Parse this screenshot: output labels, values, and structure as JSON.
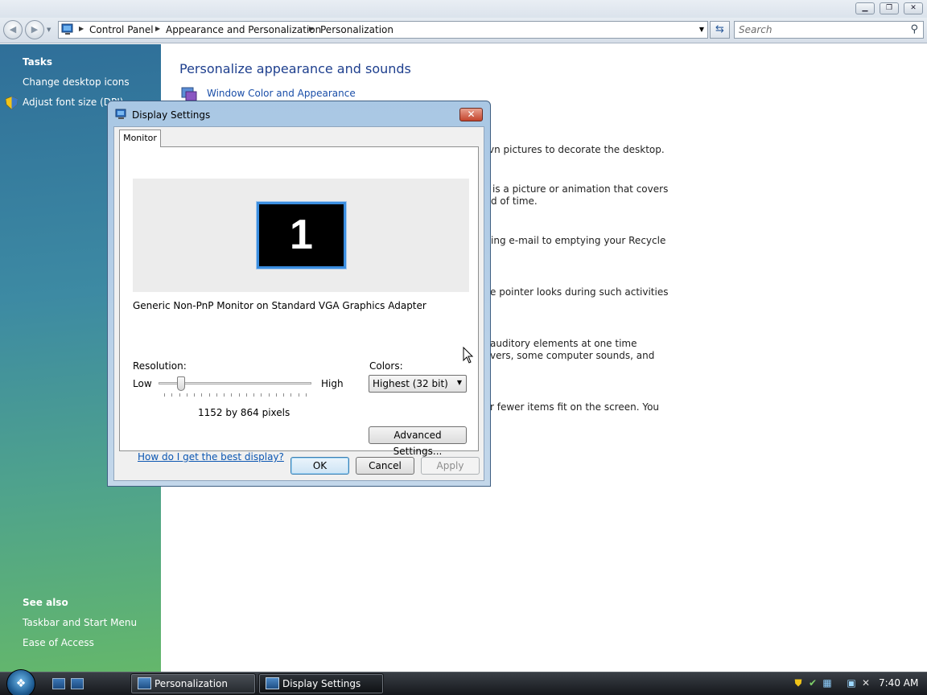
{
  "window": {
    "minimize_symbol": "▁",
    "maximize_symbol": "❐",
    "close_symbol": "✕"
  },
  "address_bar": {
    "breadcrumbs": [
      "Control Panel",
      "Appearance and Personalization",
      "Personalization"
    ],
    "search_placeholder": "Search"
  },
  "left_pane": {
    "tasks_heading": "Tasks",
    "tasks": [
      "Change desktop icons",
      "Adjust font size (DPI)"
    ],
    "see_also_heading": "See also",
    "see_also": [
      "Taskbar and Start Menu",
      "Ease of Access"
    ]
  },
  "content": {
    "title": "Personalize appearance and sounds",
    "window_color_link": "Window Color and Appearance",
    "partial_lines": [
      "vn pictures to decorate the desktop.",
      "is a picture or animation that covers",
      "d of time.",
      "ing e-mail to emptying your Recycle",
      "e pointer looks during such activities",
      "auditory elements at one time",
      "vers, some computer sounds, and",
      "r fewer items fit on the screen. You"
    ]
  },
  "dialog": {
    "title": "Display Settings",
    "tab_label": "Monitor",
    "monitor_number": "1",
    "monitor_description": "Generic Non-PnP Monitor on Standard VGA Graphics Adapter",
    "resolution_label": "Resolution:",
    "slider_low": "Low",
    "slider_high": "High",
    "slider_position_fraction": 0.12,
    "resolution_value": "1152 by 864 pixels",
    "colors_label": "Colors:",
    "colors_selected": "Highest (32 bit)",
    "help_link": "How do I get the best display?",
    "advanced_button": "Advanced Settings...",
    "ok_button": "OK",
    "cancel_button": "Cancel",
    "apply_button": "Apply"
  },
  "taskbar": {
    "buttons": [
      "Personalization",
      "Display Settings"
    ],
    "clock": "7:40 AM"
  },
  "colors": {
    "link": "#1a4ea8",
    "title": "#1e3f8e",
    "left_pane_top": "#2f6f99",
    "left_pane_bottom": "#64b76b",
    "monitor_highlight": "#3b8ee0"
  }
}
